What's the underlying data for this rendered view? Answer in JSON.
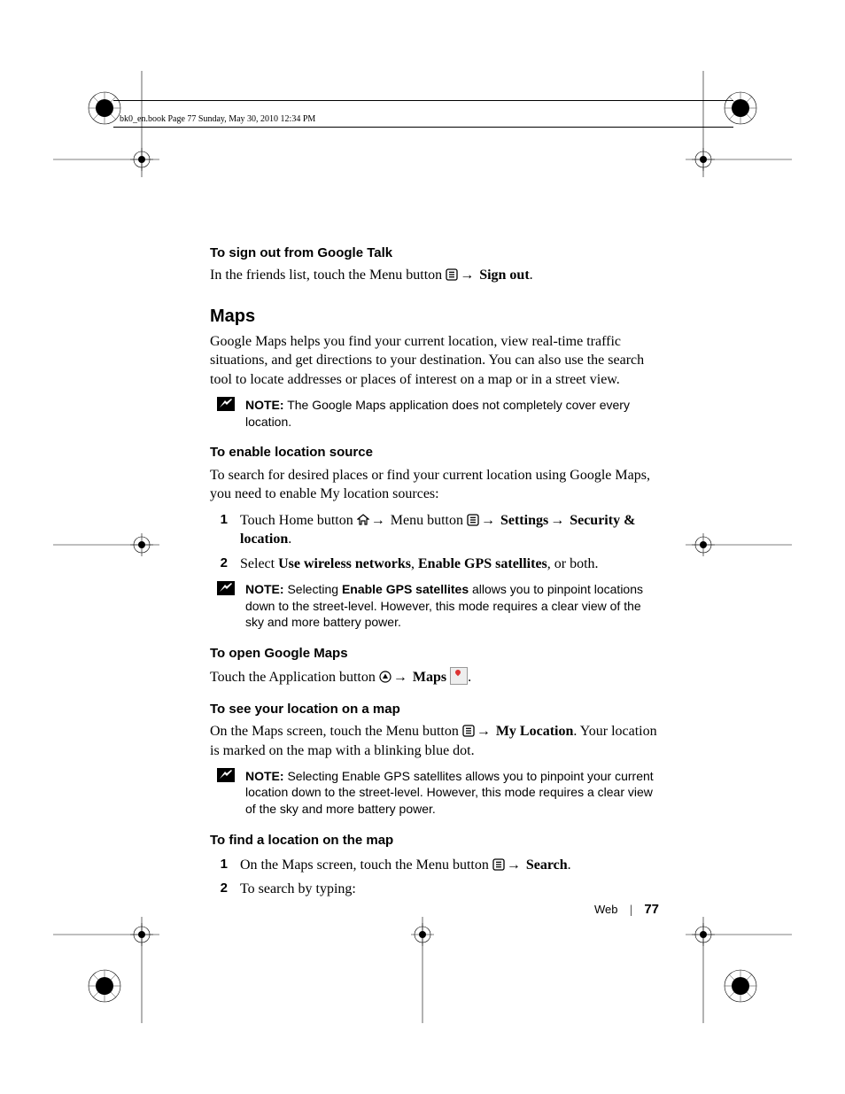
{
  "header": "bk0_en.book  Page 77  Sunday, May 30, 2010  12:34 PM",
  "footer": {
    "section": "Web",
    "page": "77"
  },
  "task1": {
    "heading": "To sign out from Google Talk",
    "line_a": "In the friends list, touch the Menu button ",
    "line_b": " Sign out",
    "period": "."
  },
  "maps": {
    "heading": "Maps",
    "intro": "Google Maps helps you find your current location, view real-time traffic situations, and get directions to your destination. You can also use the search tool to locate addresses or places of interest on a map or in a street view.",
    "note1_label": "NOTE:",
    "note1": " The Google Maps application does not completely cover every location."
  },
  "enable": {
    "heading": "To enable location source",
    "intro": "To search for desired places or find your current location using Google Maps, you need to enable My location sources:",
    "s1_a": "Touch Home button ",
    "s1_b": " Menu button ",
    "s1_c": " Settings",
    "s1_d": " Security & location",
    "s1_period": ".",
    "s2_a": "Select ",
    "s2_b": "Use wireless networks",
    "s2_c": ", ",
    "s2_d": "Enable GPS satellites",
    "s2_e": ", or both.",
    "note_label": "NOTE:",
    "note_a": " Selecting ",
    "note_b": "Enable GPS satellites",
    "note_c": " allows you to pinpoint locations down to the street-level. However, this mode requires a clear view of the sky and more battery power."
  },
  "open": {
    "heading": "To open Google Maps",
    "a": "Touch the Application button ",
    "b": " Maps ",
    "period": "."
  },
  "see": {
    "heading": "To see your location on a map",
    "a": "On the Maps screen, touch the Menu button ",
    "b": " My Location",
    "c": ". Your location is marked on the map with a blinking blue dot.",
    "note_label": "NOTE:",
    "note": " Selecting Enable GPS satellites allows you to pinpoint your current location down to the street-level. However, this mode requires a clear view of the sky and more battery power."
  },
  "find": {
    "heading": "To find a location on the map",
    "s1_a": "On the Maps screen, touch the Menu button ",
    "s1_b": " Search",
    "s1_period": ".",
    "s2": "To search by typing:"
  },
  "glyphs": {
    "arrow": "→"
  }
}
